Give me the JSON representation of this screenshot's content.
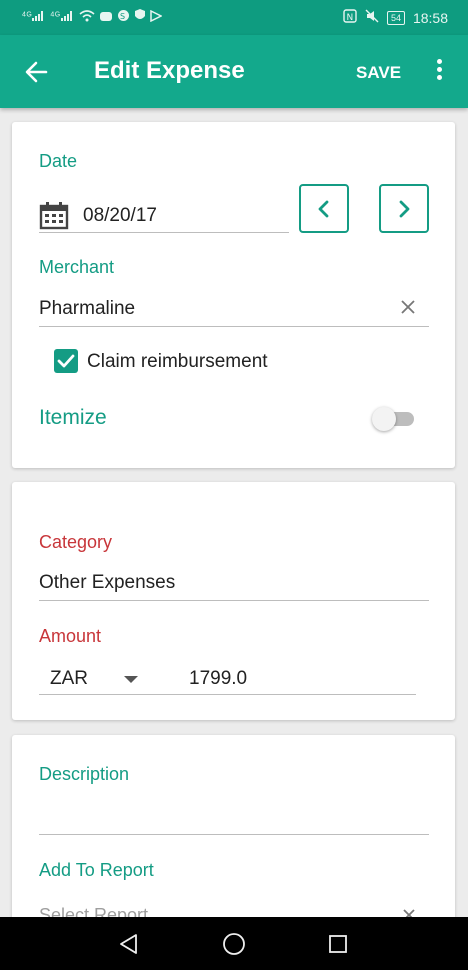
{
  "status_bar": {
    "signal_1": "4G",
    "signal_2": "4G",
    "battery": "54",
    "time": "18:58"
  },
  "app_bar": {
    "title": "Edit Expense",
    "save_label": "SAVE"
  },
  "card1": {
    "date_label": "Date",
    "date_value": "08/20/17",
    "merchant_label": "Merchant",
    "merchant_value": "Pharmaline",
    "claim_label": "Claim reimbursement",
    "claim_checked": true,
    "itemize_label": "Itemize",
    "itemize_on": false
  },
  "card2": {
    "category_label": "Category",
    "category_value": "Other Expenses",
    "amount_label": "Amount",
    "currency": "ZAR",
    "amount_value": "1799.0"
  },
  "card3": {
    "description_label": "Description",
    "description_value": "",
    "report_label": "Add To Report",
    "report_placeholder": "Select Report"
  },
  "colors": {
    "primary": "#13a98c",
    "accent_text": "#149c84",
    "required_label": "#c8363a"
  }
}
